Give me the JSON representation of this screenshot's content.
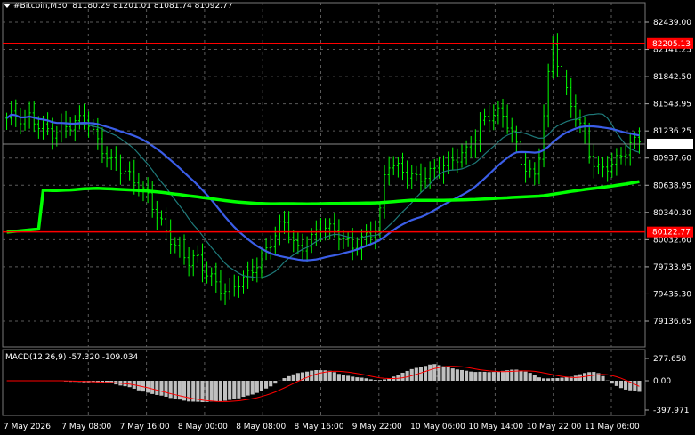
{
  "symbol": {
    "name": "#Bitcoin,M30",
    "ohlc": "81180.29 81201.01 81081.74 81092.77"
  },
  "macd": {
    "label": "MACD(12,26,9) -57.320 -109.034"
  },
  "colors": {
    "background": "#000000",
    "candle": "#00ff00",
    "grid": "#5a5a5a",
    "level_line": "#ff0000",
    "ma_fast": "#1e7a7a",
    "ma_mid": "#3b5ee8",
    "ma_slow": "#00ff00",
    "macd_hist": "#c0c0c0",
    "macd_signal": "#ff0000"
  },
  "price_axis": {
    "ticks": [
      "82439.00",
      "82141.25",
      "81842.50",
      "81543.95",
      "81236.25",
      "80937.60",
      "80638.95",
      "80340.30",
      "80032.60",
      "79733.95",
      "79435.30",
      "79136.65"
    ]
  },
  "macd_axis": {
    "ticks": [
      "277.658",
      "0.00",
      "-397.971"
    ]
  },
  "time_axis": {
    "labels": [
      "7 May 2026",
      "7 May 08:00",
      "7 May 16:00",
      "8 May 00:00",
      "8 May 08:00",
      "8 May 16:00",
      "9 May 22:00",
      "10 May 06:00",
      "10 May 14:00",
      "10 May 22:00",
      "11 May 06:00"
    ]
  },
  "levels": [
    {
      "price": 82205.13,
      "label": "82205.13"
    },
    {
      "price": 80122.77,
      "label": "80122.77"
    }
  ],
  "current_price": {
    "price": 81092.77,
    "label": "81092.77"
  },
  "chart_data": {
    "type": "candlestick",
    "y_range": [
      79136.65,
      82439.0
    ],
    "close_series": [
      81380,
      81420,
      81350,
      81400,
      81300,
      81250,
      81200,
      81280,
      81300,
      81350,
      81400,
      81200,
      81050,
      80900,
      80850,
      80780,
      80700,
      80600,
      80500,
      80300,
      80150,
      80000,
      79900,
      79800,
      79850,
      79700,
      79600,
      79500,
      79450,
      79550,
      79600,
      79700,
      79800,
      79950,
      80100,
      80250,
      80050,
      79900,
      80000,
      80100,
      80200,
      80150,
      80100,
      80000,
      79950,
      80050,
      80100,
      80200,
      80900,
      80850,
      80800,
      80750,
      80700,
      80750,
      80800,
      80850,
      80900,
      80950,
      81000,
      81100,
      81350,
      81400,
      81450,
      81380,
      81200,
      80900,
      80800,
      80700,
      81500,
      82200,
      81900,
      81600,
      81400,
      81200,
      80900,
      80800,
      80850,
      80900,
      81000,
      81100,
      81150
    ]
  }
}
